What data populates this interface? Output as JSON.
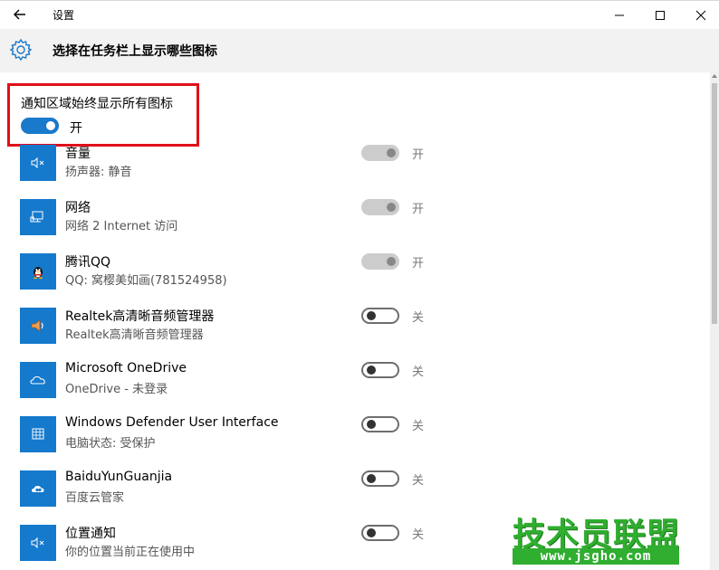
{
  "window": {
    "title": "设置",
    "icons": {
      "back": "arrow-left-icon",
      "minimize": "minimize-icon",
      "maximize": "maximize-icon",
      "close": "close-icon"
    }
  },
  "header": {
    "icon": "gear-icon",
    "title": "选择在任务栏上显示哪些图标"
  },
  "master": {
    "label": "通知区域始终显示所有图标",
    "state": "开",
    "on": true
  },
  "items": [
    {
      "icon": "speaker-muted-icon",
      "title": "音量",
      "subtitle": "扬声器: 静音",
      "state": "开",
      "toggle": "on-disabled"
    },
    {
      "icon": "network-icon",
      "title": "网络",
      "subtitle": "网络  2 Internet 访问",
      "state": "开",
      "toggle": "on-disabled"
    },
    {
      "icon": "qq-penguin-icon",
      "title": "腾讯QQ",
      "subtitle": "QQ: 窝樱美如画(781524958)",
      "state": "开",
      "toggle": "on-disabled"
    },
    {
      "icon": "realtek-speaker-icon",
      "title": "Realtek高清晰音频管理器",
      "subtitle": "Realtek高清晰音频管理器",
      "state": "关",
      "toggle": "off"
    },
    {
      "icon": "onedrive-cloud-icon",
      "title": "Microsoft OneDrive",
      "subtitle": "OneDrive - 未登录",
      "state": "关",
      "toggle": "off"
    },
    {
      "icon": "defender-icon",
      "title": "Windows Defender User Interface",
      "subtitle": "电脑状态: 受保护",
      "state": "关",
      "toggle": "off"
    },
    {
      "icon": "baidu-cloud-icon",
      "title": "BaiduYunGuanjia",
      "subtitle": "百度云管家",
      "state": "关",
      "toggle": "off"
    },
    {
      "icon": "speaker-muted-icon",
      "title": "位置通知",
      "subtitle": "你的位置当前正在使用中",
      "state": "关",
      "toggle": "off"
    }
  ],
  "watermark": {
    "text": "技术员联盟",
    "url": "www.jsgho.com"
  },
  "colors": {
    "accent": "#1979ca",
    "highlight_border": "#e0101a",
    "tile": "#1579cc",
    "watermark": "#2fae2f"
  }
}
